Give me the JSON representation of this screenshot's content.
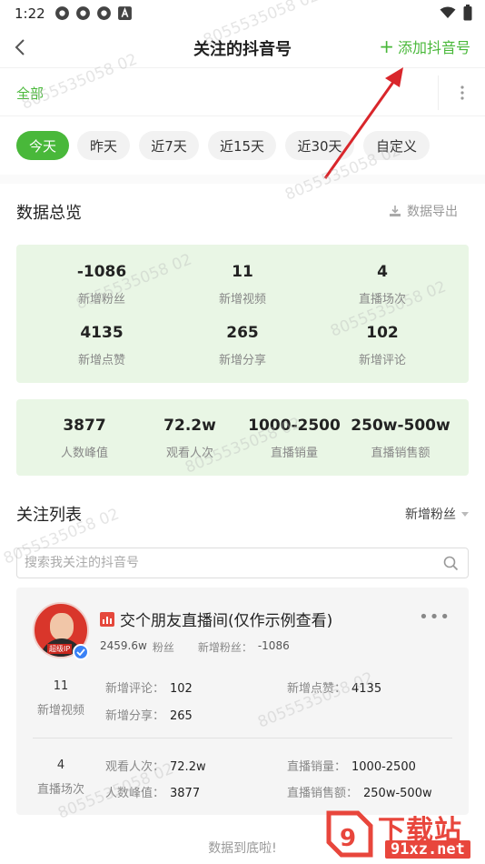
{
  "status_bar": {
    "time": "1:22"
  },
  "nav": {
    "title": "关注的抖音号",
    "add_label": "添加抖音号"
  },
  "group": {
    "selected": "全部"
  },
  "date_filters": [
    "今天",
    "昨天",
    "近7天",
    "近15天",
    "近30天",
    "自定义"
  ],
  "overview": {
    "title": "数据总览",
    "export_label": "数据导出",
    "stats": [
      {
        "value": "-1086",
        "label": "新增粉丝"
      },
      {
        "value": "11",
        "label": "新增视频"
      },
      {
        "value": "4",
        "label": "直播场次"
      },
      {
        "value": "4135",
        "label": "新增点赞"
      },
      {
        "value": "265",
        "label": "新增分享"
      },
      {
        "value": "102",
        "label": "新增评论"
      }
    ],
    "live_stats": [
      {
        "value": "3877",
        "label": "人数峰值"
      },
      {
        "value": "72.2w",
        "label": "观看人次"
      },
      {
        "value": "1000-2500",
        "label": "直播销量"
      },
      {
        "value": "250w-500w",
        "label": "直播销售额"
      }
    ]
  },
  "list": {
    "title": "关注列表",
    "sort_label": "新增粉丝",
    "search_placeholder": "搜索我关注的抖音号"
  },
  "account": {
    "name": "交个朋友直播间(仅作示例查看)",
    "avatar_tag": "超级IP",
    "followers": "2459.6w",
    "followers_label": "粉丝",
    "new_fans_label": "新增粉丝：",
    "new_fans": "-1086",
    "video_block": {
      "count": "11",
      "label": "新增视频",
      "items": [
        {
          "label": "新增评论：",
          "value": "102"
        },
        {
          "label": "新增点赞：",
          "value": "4135"
        },
        {
          "label": "新增分享：",
          "value": "265"
        }
      ]
    },
    "live_block": {
      "count": "4",
      "label": "直播场次",
      "items": [
        {
          "label": "观看人次：",
          "value": "72.2w"
        },
        {
          "label": "直播销量：",
          "value": "1000-2500"
        },
        {
          "label": "人数峰值：",
          "value": "3877"
        },
        {
          "label": "直播销售额：",
          "value": "250w-500w"
        }
      ]
    }
  },
  "footer": {
    "end_text": "数据到底啦!"
  },
  "brand": {
    "main": "下载站",
    "sub": "91xz.net"
  },
  "watermark": "8055535058 02",
  "colors": {
    "accent": "#49b83a",
    "card_bg": "#e9f6e5",
    "arrow": "#d9262b"
  }
}
